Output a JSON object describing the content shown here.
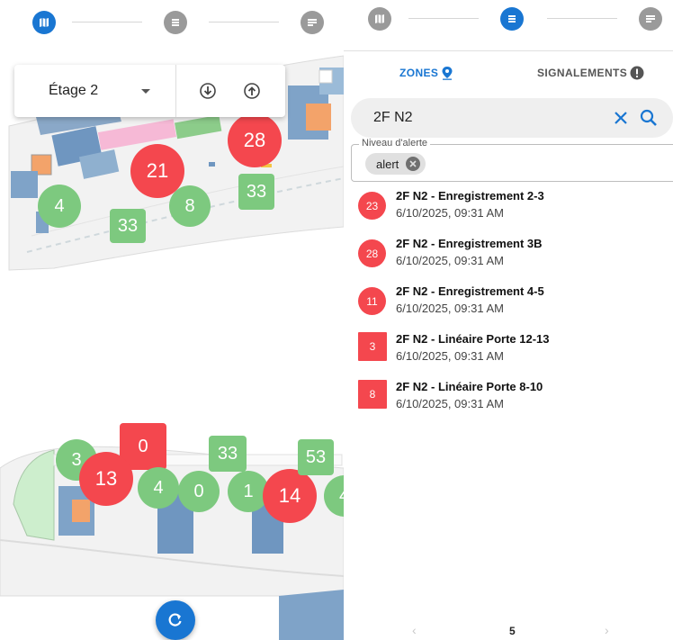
{
  "colors": {
    "primary": "#1976d2",
    "alert_red": "#f4474e",
    "ok_green": "#7dc97f",
    "idle_gray": "#9a9a9a"
  },
  "map": {
    "floor_select": {
      "value": "Étage 2"
    },
    "icons": {
      "floor_down": "arrow-down-circle-icon",
      "floor_up": "arrow-up-circle-icon",
      "refresh": "refresh-icon"
    },
    "markers": [
      {
        "value": "28",
        "status": "red"
      },
      {
        "value": "21",
        "status": "red"
      },
      {
        "value": "4",
        "status": "green"
      },
      {
        "value": "33",
        "status": "green"
      },
      {
        "value": "8",
        "status": "green"
      },
      {
        "value": "33",
        "status": "green"
      },
      {
        "value": "3",
        "status": "green"
      },
      {
        "value": "0",
        "status": "red"
      },
      {
        "value": "13",
        "status": "red"
      },
      {
        "value": "4",
        "status": "green"
      },
      {
        "value": "0",
        "status": "green"
      },
      {
        "value": "33",
        "status": "green"
      },
      {
        "value": "1",
        "status": "green"
      },
      {
        "value": "14",
        "status": "red"
      },
      {
        "value": "53",
        "status": "green"
      },
      {
        "value": "4",
        "status": "green"
      }
    ]
  },
  "stepper": {
    "steps": [
      "map-icon",
      "list-icon",
      "report-icon"
    ],
    "active_left": 0,
    "active_right": 1
  },
  "panel": {
    "tabs": {
      "zones": "ZONES",
      "signalements": "SIGNALEMENTS"
    },
    "search": {
      "value": "2F N2"
    },
    "filter": {
      "legend": "Niveau d'alerte",
      "chip": "alert"
    },
    "items": [
      {
        "badge": "23",
        "title": "2F N2 - Enregistrement 2-3",
        "date": "6/10/2025, 09:31 AM"
      },
      {
        "badge": "28",
        "title": "2F N2 - Enregistrement 3B",
        "date": "6/10/2025, 09:31 AM"
      },
      {
        "badge": "11",
        "title": "2F N2 - Enregistrement 4-5",
        "date": "6/10/2025, 09:31 AM"
      },
      {
        "badge": "3",
        "title": "2F N2 - Linéaire Porte 12-13",
        "date": "6/10/2025, 09:31 AM"
      },
      {
        "badge": "8",
        "title": "2F N2 - Linéaire Porte 8-10",
        "date": "6/10/2025, 09:31 AM"
      }
    ],
    "pagination": {
      "prev": "‹",
      "page": "5",
      "next": "›"
    }
  }
}
